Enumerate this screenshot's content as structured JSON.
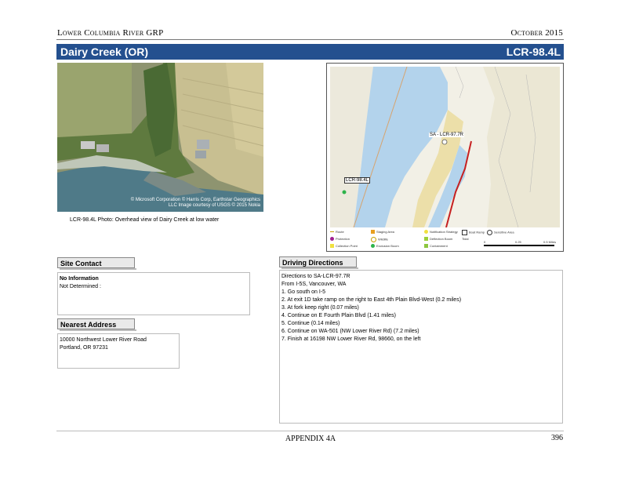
{
  "header": {
    "left": "Lower Columbia River GRP",
    "right": "October 2015"
  },
  "title": {
    "site_name": "Dairy Creek (OR)",
    "site_code": "LCR-98.4L"
  },
  "photo": {
    "credit_line1": "© Microsoft Corporation © Harris Corp, Earthstar Geographics",
    "credit_line2": "LLC Image courtesy of USGS © 2015 Nokia",
    "caption": "LCR-98.4L Photo: Overhead view of Dairy Creek at low water"
  },
  "map": {
    "label_1": "SA - LCR-97.7R",
    "label_2": "LCR-98.4L",
    "legend": {
      "item_1": "Route",
      "item_2": "Protection",
      "item_3": "Collection Point",
      "item_4": "Staging Area",
      "item_5": "Wildlife",
      "item_6": "Exclusion Boom",
      "item_7": "Notification Strategy",
      "item_8": "Deflection Boom",
      "item_9": "Containment",
      "item_10": "Boat Ramp",
      "item_11": "Tidal",
      "item_12": "Sensitive Area",
      "scale_0": "0",
      "scale_1": "0.25",
      "scale_2": "0.5 Miles"
    }
  },
  "site_contact": {
    "label": "Site Contact",
    "name": "No Information",
    "detail": "Not Determined :"
  },
  "nearest_address": {
    "label": "Nearest Address",
    "line1": "10000 Northwest Lower River Road",
    "line2": "Portland, OR 97231"
  },
  "driving_directions": {
    "label": "Driving Directions",
    "lines": [
      "Directions to SA-LCR-97.7R",
      "From I-5S, Vancouver, WA",
      "1. Go south on I-5",
      "2. At exit 1D take ramp on the right to East 4th Plain Blvd-West (0.2 miles)",
      "3. At fork keep right (0.07 miles)",
      "4. Continue on E Fourth Plain Blvd (1.41 miles)",
      "5. Continue (0.14 miles)",
      "6. Continue on WA-501 (NW Lower River Rd) (7.2 miles)",
      "7. Finish at 16198 NW Lower River Rd, 98660, on the left"
    ]
  },
  "footer": {
    "center": "APPENDIX 4A",
    "page": "396"
  }
}
